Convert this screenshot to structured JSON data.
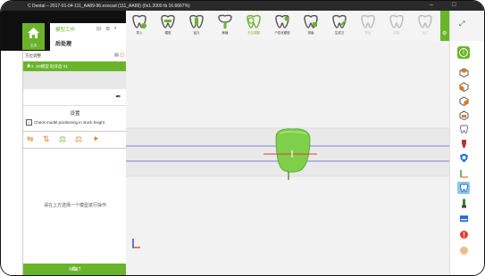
{
  "window": {
    "title": "C Dental – 2017-01-04-111_AA89-96.exocad (111_AA89) (0x1.2000 fà 16.6667%)",
    "controls": [
      "–",
      "□",
      "×"
    ]
  },
  "left_panel": {
    "home_label": "主页",
    "tab_label": "模型工作",
    "process_label": "后处理",
    "section_label": "方位调整",
    "selected_item": "1. 2. 3D模型 贴牙齿 01",
    "settings_title": "设置",
    "checkbox_label": "Check model positioning in stock height",
    "checkbox_checked": true,
    "hint_text": "请在上方选择一个模型进行操作",
    "next_label": "NEXT"
  },
  "toolbar": {
    "tools": [
      {
        "label": "导入",
        "state": "normal"
      },
      {
        "label": "模型",
        "state": "normal"
      },
      {
        "label": "钻孔",
        "state": "normal"
      },
      {
        "label": "种植",
        "state": "normal"
      },
      {
        "label": "方位调整",
        "state": "active"
      },
      {
        "label": "个性化模型",
        "state": "normal"
      },
      {
        "label": "排版",
        "state": "normal"
      },
      {
        "label": "生成刀",
        "state": "normal"
      },
      {
        "label": "导出",
        "state": "dim"
      },
      {
        "label": "仿真",
        "state": "dim"
      },
      {
        "label": "加工",
        "state": "dim"
      }
    ]
  },
  "colors": {
    "accent": "#6ab42b",
    "titlebar": "#2a2a2a",
    "viewport": "#f2f2f2"
  },
  "right_bar": {
    "icons": [
      "expand-icon",
      "info-icon",
      "cube-front-icon",
      "cube-top-icon",
      "cube-side-icon",
      "cube-iso-icon",
      "tooth-icon",
      "tooth-red-icon",
      "shield-icon",
      "axis-icon",
      "tooth-blue-icon",
      "tool-icon",
      "card-icon",
      "alert-icon",
      "orange-icon"
    ]
  }
}
